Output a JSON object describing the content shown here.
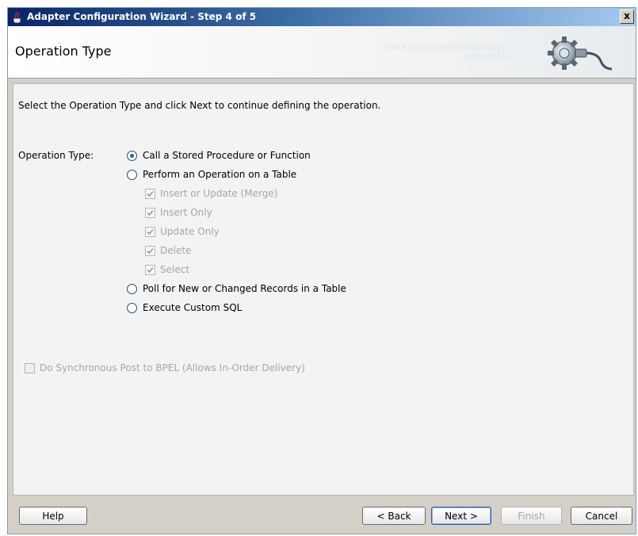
{
  "window": {
    "title": "Adapter Configuration Wizard - Step 4 of 5",
    "close_label": "x"
  },
  "header": {
    "title": "Operation Type",
    "binary_line1": "01010101010101010101010101",
    "binary_line2": "0101010110"
  },
  "instruction": "Select the Operation Type and click Next to continue defining the operation.",
  "operation_type": {
    "label": "Operation Type:",
    "options": [
      {
        "label": "Call a Stored Procedure or Function",
        "selected": true
      },
      {
        "label": "Perform an Operation on a Table",
        "selected": false
      },
      {
        "label": "Poll for New or Changed Records in a Table",
        "selected": false
      },
      {
        "label": "Execute Custom SQL",
        "selected": false
      }
    ],
    "table_operations": [
      {
        "label": "Insert or Update (Merge)",
        "checked": true,
        "enabled": false
      },
      {
        "label": "Insert Only",
        "checked": true,
        "enabled": false
      },
      {
        "label": "Update Only",
        "checked": true,
        "enabled": false
      },
      {
        "label": "Delete",
        "checked": true,
        "enabled": false
      },
      {
        "label": "Select",
        "checked": true,
        "enabled": false
      }
    ]
  },
  "sync_post": {
    "label": "Do Synchronous Post to BPEL (Allows In-Order Delivery)",
    "checked": false,
    "enabled": false
  },
  "buttons": {
    "help": "Help",
    "back": "< Back",
    "next": "Next >",
    "finish": "Finish",
    "cancel": "Cancel"
  },
  "colors": {
    "title_bar_start": "#0a246a",
    "title_bar_end": "#a6caf0",
    "radio_selected": "#2a5db0",
    "disabled_text": "#a6a6a6"
  }
}
